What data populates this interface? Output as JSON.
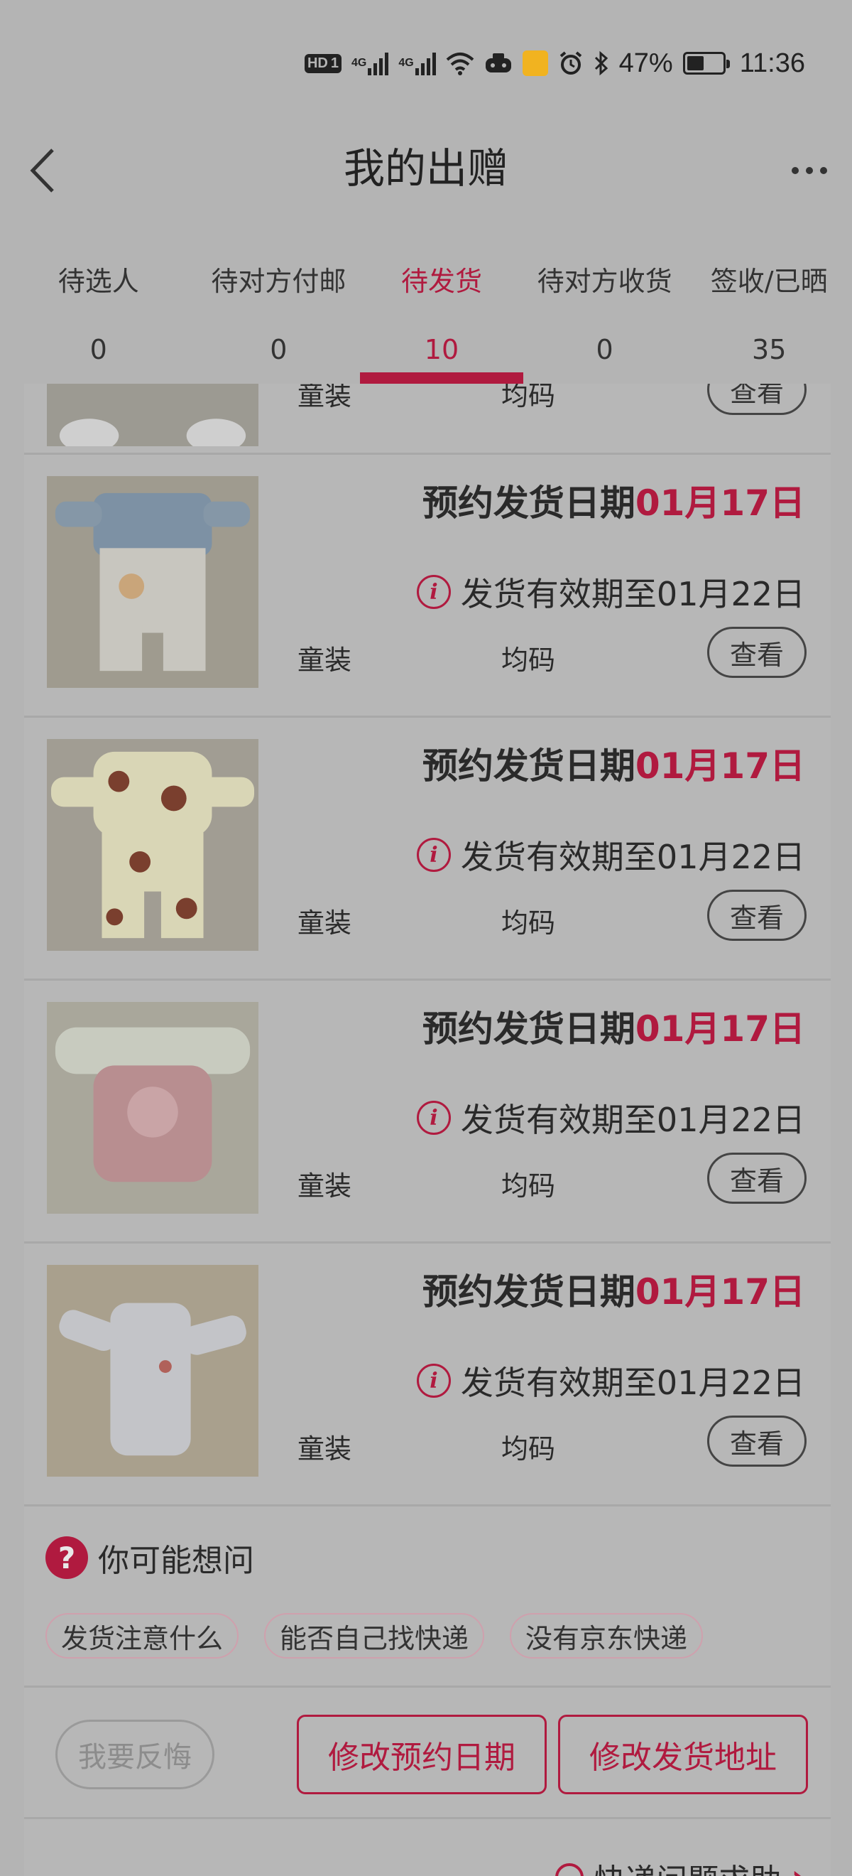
{
  "status_bar": {
    "hd": "HD",
    "sim": "1",
    "net1": "4G",
    "net2": "4G",
    "battery_text": "47%",
    "battery_level": 0.47,
    "time": "11:36"
  },
  "header": {
    "title": "我的出赠"
  },
  "tabs": [
    {
      "label": "待选人",
      "count": "0",
      "active": false
    },
    {
      "label": "待对方付邮",
      "count": "0",
      "active": false
    },
    {
      "label": "待发货",
      "count": "10",
      "active": true
    },
    {
      "label": "待对方收货",
      "count": "0",
      "active": false
    },
    {
      "label": "签收/已晒",
      "count": "35",
      "active": false
    }
  ],
  "partial_item": {
    "category": "童装",
    "size": "均码",
    "view_label": "查看"
  },
  "items": [
    {
      "ship_label": "预约发货日期",
      "ship_date": "01月17日",
      "expire_text": "发货有效期至01月22日",
      "category": "童装",
      "size": "均码",
      "view_label": "查看"
    },
    {
      "ship_label": "预约发货日期",
      "ship_date": "01月17日",
      "expire_text": "发货有效期至01月22日",
      "category": "童装",
      "size": "均码",
      "view_label": "查看"
    },
    {
      "ship_label": "预约发货日期",
      "ship_date": "01月17日",
      "expire_text": "发货有效期至01月22日",
      "category": "童装",
      "size": "均码",
      "view_label": "查看"
    },
    {
      "ship_label": "预约发货日期",
      "ship_date": "01月17日",
      "expire_text": "发货有效期至01月22日",
      "category": "童装",
      "size": "均码",
      "view_label": "查看"
    }
  ],
  "faq": {
    "title": "你可能想问",
    "tags": [
      "发货注意什么",
      "能否自己找快递",
      "没有京东快递"
    ]
  },
  "actions": {
    "regret": "我要反悔",
    "change_date": "修改预约日期",
    "change_address": "修改发货地址"
  },
  "help": {
    "label": "快递问题求助"
  },
  "colors": {
    "accent": "#b01a3f",
    "overlay_bg": "#b4b4b4"
  }
}
